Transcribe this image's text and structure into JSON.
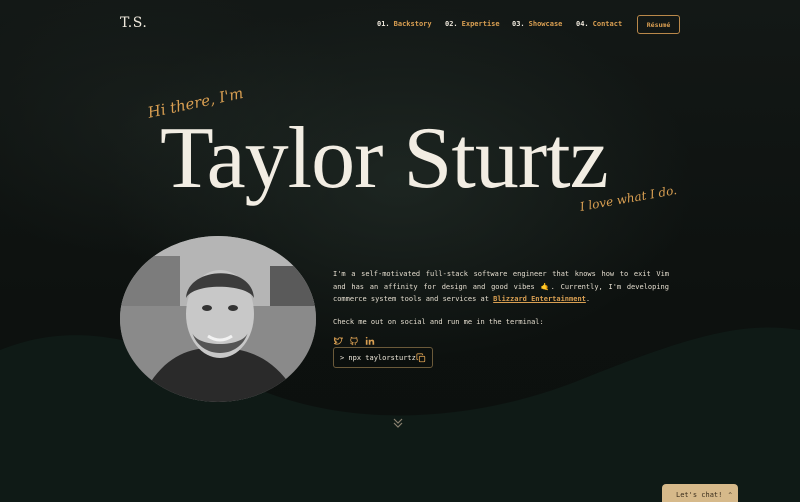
{
  "nav": {
    "logo": "T.S.",
    "links": [
      {
        "num": "01.",
        "label": "Backstory"
      },
      {
        "num": "02.",
        "label": "Expertise"
      },
      {
        "num": "03.",
        "label": "Showcase"
      },
      {
        "num": "04.",
        "label": "Contact"
      }
    ],
    "resume_label": "Résumé"
  },
  "hero": {
    "greeting": "Hi there, I'm",
    "name": "Taylor Sturtz",
    "tagline": "I love what I do."
  },
  "about": {
    "bio_before": "I'm a self-motivated full-stack software engineer that knows how to exit Vim and has an affinity for design and good vibes 🤙. Currently, I'm developing commerce system tools and services at ",
    "company": "Blizzard Entertainment",
    "bio_after": ".",
    "social_prompt": "Check me out on social and run me in the terminal:",
    "social_icons": [
      "twitter-icon",
      "github-icon",
      "linkedin-icon"
    ],
    "terminal_command": "> npx taylorsturtz"
  },
  "chat": {
    "label": "Let's chat!",
    "caret": "^"
  },
  "colors": {
    "accent": "#d99f52",
    "background": "#0e1210",
    "cream": "#f2ede3"
  }
}
